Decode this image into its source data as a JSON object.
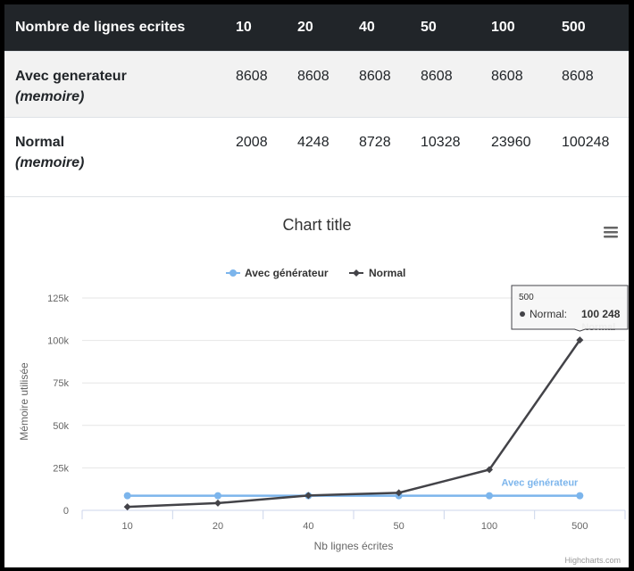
{
  "table": {
    "headers": [
      "Nombre de lignes ecrites",
      "10",
      "20",
      "40",
      "50",
      "100",
      "500"
    ],
    "rows": [
      {
        "label": "Avec generateur",
        "sublabel": "(memoire)",
        "values": [
          "8608",
          "8608",
          "8608",
          "8608",
          "8608",
          "8608"
        ]
      },
      {
        "label": "Normal",
        "sublabel": "(memoire)",
        "values": [
          "2008",
          "4248",
          "8728",
          "10328",
          "23960",
          "100248"
        ]
      }
    ]
  },
  "chart_data": {
    "type": "line",
    "title": "Chart title",
    "xlabel": "Nb lignes écrites",
    "ylabel": "Mémoire utilisée",
    "categories": [
      "10",
      "20",
      "40",
      "50",
      "100",
      "500"
    ],
    "y_ticks": [
      "0",
      "25k",
      "50k",
      "75k",
      "100k",
      "125k"
    ],
    "ylim": [
      0,
      125000
    ],
    "grid": true,
    "legend_position": "top-center",
    "series": [
      {
        "name": "Avec générateur",
        "color": "#7cb5ec",
        "marker": "circle",
        "values": [
          8608,
          8608,
          8608,
          8608,
          8608,
          8608
        ]
      },
      {
        "name": "Normal",
        "color": "#434348",
        "marker": "diamond",
        "values": [
          2008,
          4248,
          8728,
          10328,
          23960,
          100248
        ]
      }
    ],
    "tooltip": {
      "header": "500",
      "series_name": "Normal",
      "value_text": "100 248"
    },
    "credits": "Highcharts.com"
  },
  "menu_icon": "hamburger-menu-icon"
}
